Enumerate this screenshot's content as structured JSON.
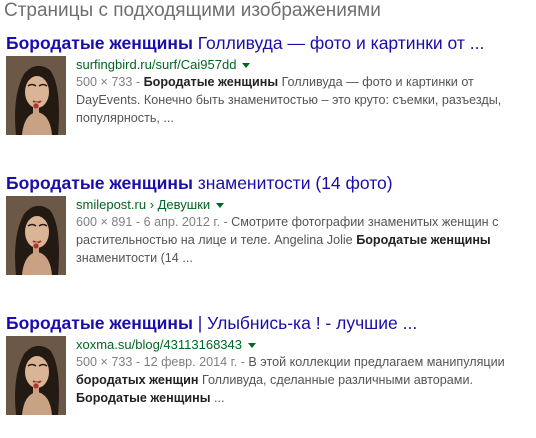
{
  "heading": "Страницы с подходящими изображениями",
  "results": [
    {
      "title_bold": "Бородатые женщины",
      "title_rest": " Голливуда — фото и картинки от ...",
      "url": "surfingbird.ru/surf/Cai957dd",
      "snippet": [
        {
          "meta": "500 × 733 - ",
          "bold": "Бородатые женщины",
          "rest": " Голливуда — фото и картинки от"
        },
        {
          "text": "DayEvents. Конечно быть знаменитостью – это круто: съемки, разъезды,"
        },
        {
          "text": "популярность, ..."
        }
      ]
    },
    {
      "title_bold": "Бородатые женщины",
      "title_rest": " знаменитости (14 фото)",
      "url": "smilepost.ru › Девушки",
      "snippet": [
        {
          "meta": "600 × 891 - 6 апр. 2012 г. - ",
          "text": "Смотрите фотографии знаменитых женщин с"
        },
        {
          "text": "растительностью на лице и теле. Angelina Jolie ",
          "bold": "Бородатые женщины"
        },
        {
          "text": "знаменитости (14 ..."
        }
      ]
    },
    {
      "title_bold": "Бородатые женщины",
      "title_rest": " | Улыбнись-ка ! - лучшие ...",
      "url": "xoxma.su/blog/43113168343",
      "snippet": [
        {
          "meta": "500 × 733 - 12 февр. 2014 г. - ",
          "text": "В этой коллекции предлагаем манипуляции"
        },
        {
          "bold": "бородатых женщин",
          "rest": " Голливуда, сделанные различными авторами."
        },
        {
          "bold": "Бородатые женщины",
          "rest": " ..."
        }
      ]
    }
  ]
}
